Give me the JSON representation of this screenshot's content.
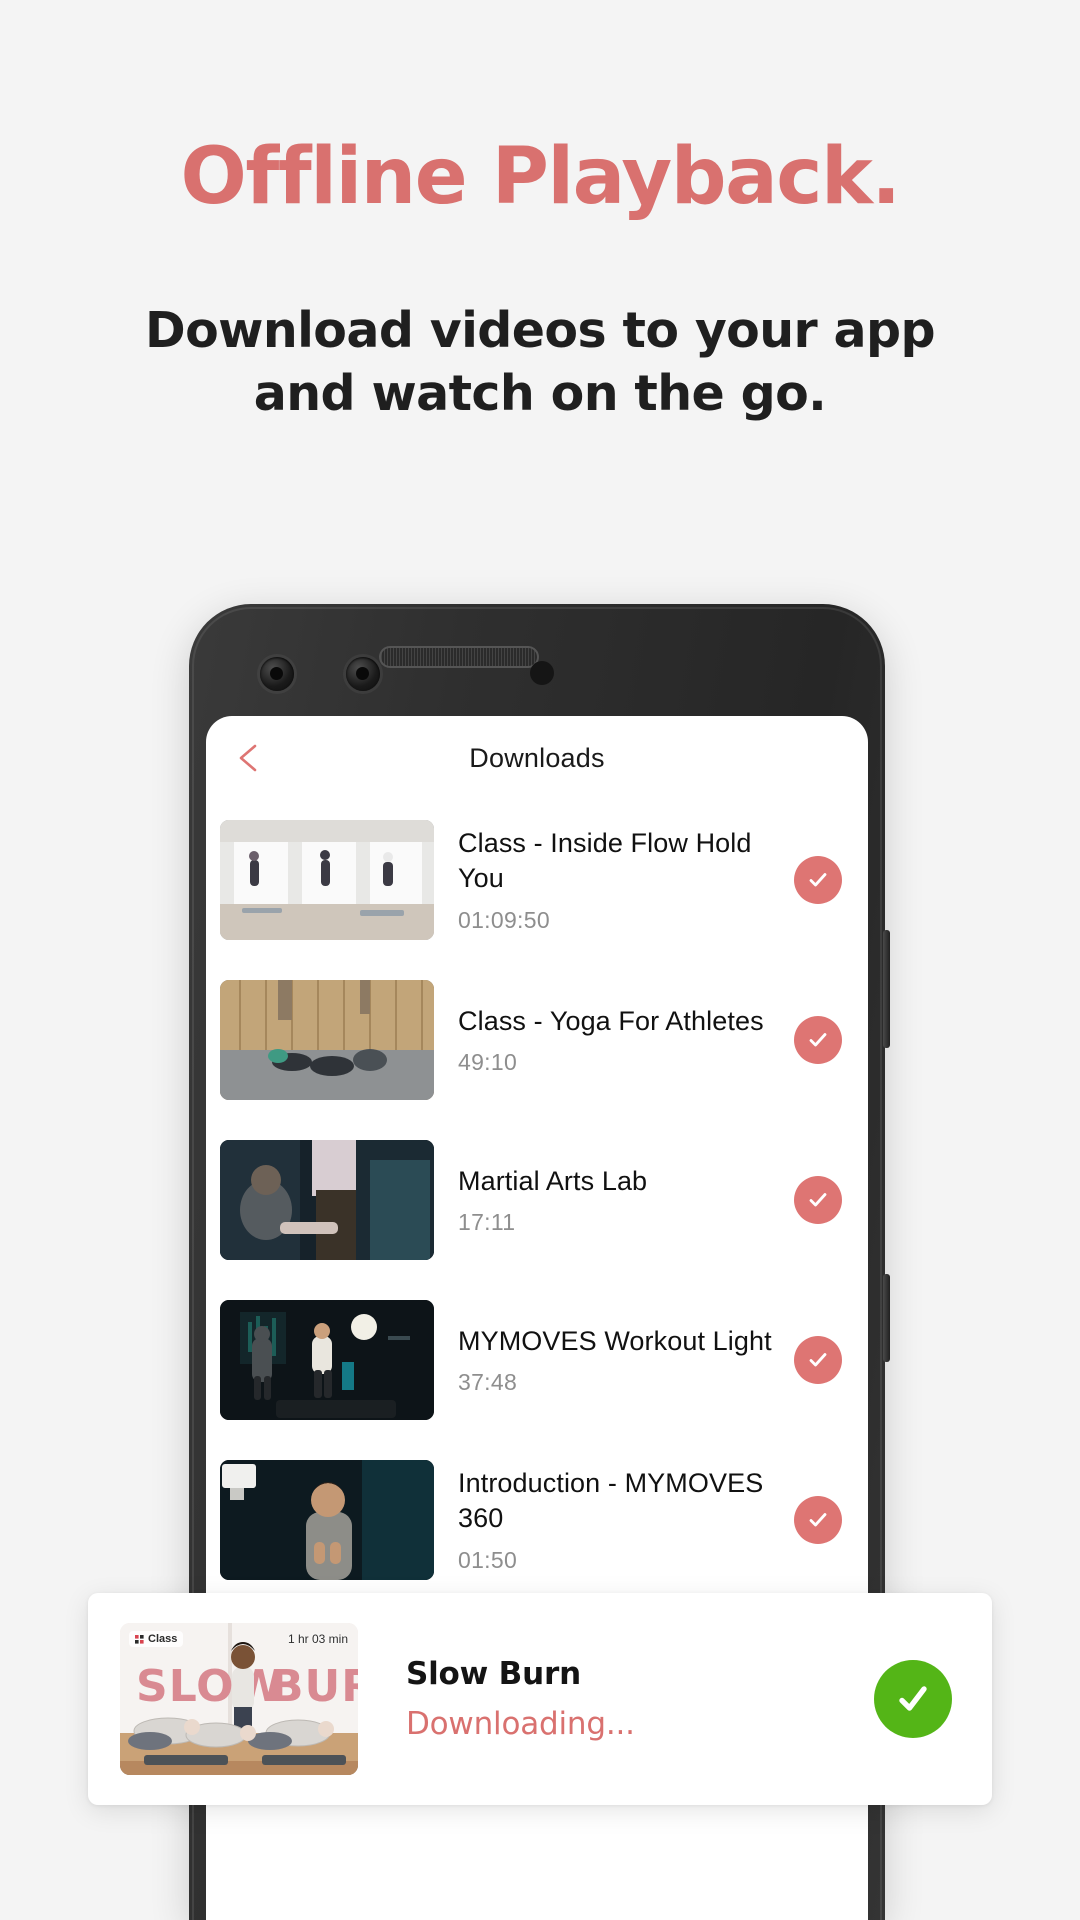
{
  "marketing": {
    "headline": "Offline Playback.",
    "subhead_line1": "Download videos to your app",
    "subhead_line2": "and watch on the go.",
    "headline_color": "#d9716f",
    "subhead_color": "#1f1f1f"
  },
  "app": {
    "header": {
      "back_icon": "back-arrow-icon",
      "title": "Downloads"
    },
    "downloads": [
      {
        "title": "Class - Inside Flow Hold You",
        "duration": "01:09:50",
        "status_icon": "check-circle-icon",
        "thumbnail": "yoga-studio-three-women-standing"
      },
      {
        "title": "Class - Yoga For Athletes",
        "duration": "49:10",
        "status_icon": "check-circle-icon",
        "thumbnail": "gym-athletes-stretching-floor"
      },
      {
        "title": "Martial Arts Lab",
        "duration": "17:11",
        "status_icon": "check-circle-icon",
        "thumbnail": "martial-arts-two-men-dark-gym"
      },
      {
        "title": "MYMOVES Workout Light",
        "duration": "37:48",
        "status_icon": "check-circle-icon",
        "thumbnail": "dark-studio-boxing-couple"
      },
      {
        "title": "Introduction - MYMOVES 360",
        "duration": "01:50",
        "status_icon": "check-circle-icon",
        "thumbnail": "man-talking-dark-studio"
      }
    ],
    "accent_pink": "#de7573"
  },
  "toast": {
    "badge_label": "Class",
    "badge_icon": "class-grid-icon",
    "badge_duration": "1 hr 03 min",
    "thumb_word1": "SLOW",
    "thumb_word2": "BURN",
    "title": "Slow Burn",
    "status": "Downloading...",
    "status_icon": "check-circle-green-icon",
    "green": "#54b517"
  }
}
